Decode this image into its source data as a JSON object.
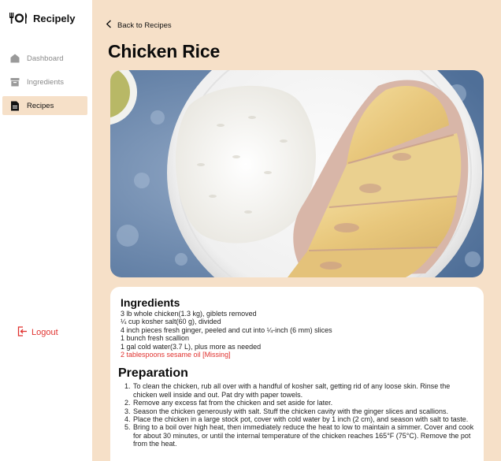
{
  "app": {
    "name": "Recipely"
  },
  "sidebar": {
    "items": [
      {
        "label": "Dashboard",
        "icon": "home-icon",
        "active": false
      },
      {
        "label": "Ingredients",
        "icon": "box-icon",
        "active": false
      },
      {
        "label": "Recipes",
        "icon": "document-icon",
        "active": true
      }
    ],
    "logout_label": "Logout"
  },
  "header": {
    "back_label": "Back to Recipes",
    "title": "Chicken Rice"
  },
  "recipe": {
    "image_alt": "Plate of sliced poached chicken with white rice",
    "ingredients_heading": "Ingredients",
    "ingredients": [
      {
        "text": "3 lb whole chicken(1.3 kg), giblets removed",
        "missing": false
      },
      {
        "text": "¼ cup kosher salt(60 g), divided",
        "missing": false
      },
      {
        "text": "4 inch pieces fresh ginger, peeled and cut into ¼-inch (6 mm) slices",
        "missing": false
      },
      {
        "text": "1 bunch fresh scallion",
        "missing": false
      },
      {
        "text": "1 gal cold water(3.7 L), plus more as needed",
        "missing": false
      },
      {
        "text": "2 tablespoons sesame oil [Missing]",
        "missing": true
      }
    ],
    "preparation_heading": "Preparation",
    "steps": [
      "To clean the chicken, rub all over with a handful of kosher salt, getting rid of any loose skin. Rinse the chicken well inside and out. Pat dry with paper towels.",
      "Remove any excess fat from the chicken and set aside for later.",
      "Season the chicken generously with salt. Stuff the chicken cavity with the ginger slices and scallions.",
      "Place the chicken in a large stock pot, cover with cold water by 1 inch (2 cm), and season with salt to taste.",
      "Bring to a boil over high heat, then immediately reduce the heat to low to maintain a simmer. Cover and cook for about 30 minutes, or until the internal temperature of the chicken reaches 165°F (75°C). Remove the pot from the heat."
    ]
  },
  "colors": {
    "background": "#f6e0c8",
    "sidebar": "#ffffff",
    "active_item": "#f6e0c8",
    "danger": "#e0322f"
  }
}
